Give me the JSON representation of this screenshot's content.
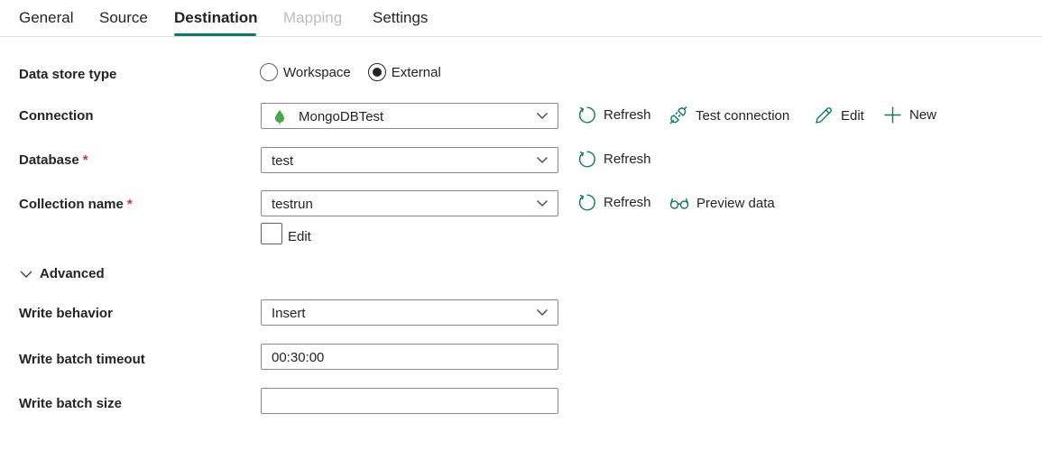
{
  "tabs": {
    "general": "General",
    "source": "Source",
    "destination": "Destination",
    "mapping": "Mapping",
    "settings": "Settings",
    "active": "Destination"
  },
  "form": {
    "data_store_type": {
      "label": "Data store type",
      "options": {
        "workspace": "Workspace",
        "external": "External"
      },
      "selected": "External"
    },
    "connection": {
      "label": "Connection",
      "value": "MongoDBTest",
      "icon": "mongodb-leaf-icon",
      "actions": {
        "refresh": "Refresh",
        "test_connection": "Test connection",
        "edit": "Edit",
        "new": "New"
      }
    },
    "database": {
      "label": "Database",
      "required_mark": "*",
      "value": "test",
      "refresh": "Refresh"
    },
    "collection": {
      "label": "Collection name",
      "required_mark": "*",
      "value": "testrun",
      "refresh": "Refresh",
      "preview": "Preview data",
      "edit_checkbox_label": "Edit",
      "edit_checked": false
    },
    "advanced": {
      "label": "Advanced",
      "expanded": true
    },
    "write_behavior": {
      "label": "Write behavior",
      "value": "Insert"
    },
    "write_batch_timeout": {
      "label": "Write batch timeout",
      "value": "00:30:00"
    },
    "write_batch_size": {
      "label": "Write batch size",
      "value": ""
    }
  },
  "colors": {
    "accent": "#117865",
    "required": "#c4314b",
    "mongodb_leaf": "#4aa84c",
    "disabled_text": "#bdbdbd"
  }
}
